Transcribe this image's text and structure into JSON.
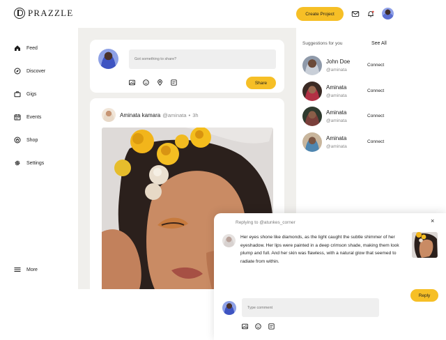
{
  "app": {
    "logo_text": "PRAZZLE"
  },
  "header": {
    "create_project_label": "Create Project"
  },
  "sidebar": {
    "items": [
      {
        "label": "Feed",
        "icon": "home-icon"
      },
      {
        "label": "Discover",
        "icon": "compass-icon"
      },
      {
        "label": "Gigs",
        "icon": "briefcase-icon"
      },
      {
        "label": "Events",
        "icon": "calendar-icon"
      },
      {
        "label": "Shop",
        "icon": "shop-icon"
      },
      {
        "label": "Settings",
        "icon": "gear-icon"
      }
    ],
    "more_label": "More"
  },
  "composer": {
    "placeholder": "Got something to share?",
    "share_label": "Share"
  },
  "post": {
    "author": "Aminata kamara",
    "handle": "@aminata",
    "separator": "•",
    "time": "3h"
  },
  "suggestions": {
    "title": "Suggestions for you",
    "see_all": "See All",
    "items": [
      {
        "name": "John Doe",
        "handle": "@aminata",
        "action": "Connect"
      },
      {
        "name": "Aminata",
        "handle": "@aminata",
        "action": "Connect"
      },
      {
        "name": "Aminata",
        "handle": "@aminata",
        "action": "Connect"
      },
      {
        "name": "Aminata",
        "handle": "@aminata",
        "action": "Connect"
      }
    ]
  },
  "reply": {
    "close": "×",
    "replying_to": "Replying to @atunkes_corner",
    "text": "Her eyes shone like diamonds, as the light caught the subtle shimmer of her eyeshadow. Her lips were painted in a deep crimson shade, making them look plump and full. And her skin was flawless, with a natural glow that seemed to radiate from within.",
    "reply_label": "Reply",
    "comment_placeholder": "Type comment"
  },
  "colors": {
    "accent": "#f6bf26",
    "feed_bg": "#f0efec"
  }
}
